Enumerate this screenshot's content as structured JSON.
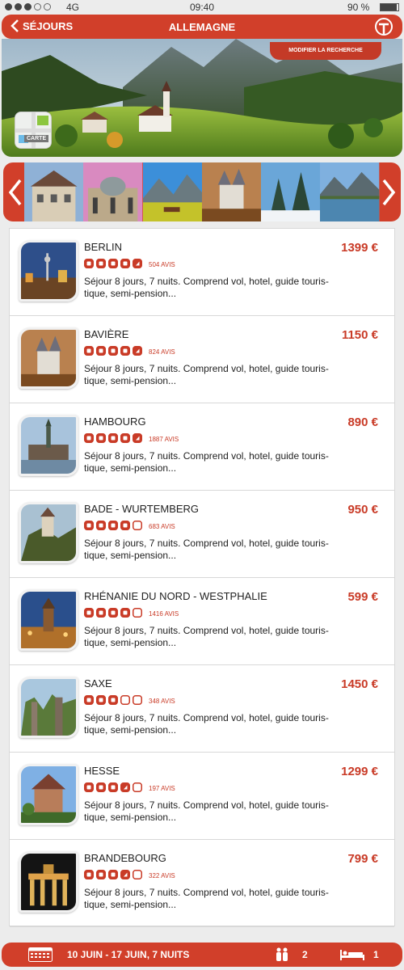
{
  "status": {
    "network": "4G",
    "time": "09:40",
    "battery_text": "90 %",
    "battery_level": 0.9,
    "signal_bars": 5,
    "signal_filled": 3
  },
  "nav": {
    "back_label": "SÉJOURS",
    "title": "ALLEMAGNE",
    "logo_icon": "brand-logo-icon"
  },
  "hero": {
    "modify_label": "MODIFIER LA RECHERCHE",
    "map_label": "CARTE"
  },
  "carousel": {
    "thumbs": [
      "city-hall",
      "palace",
      "alpine-lake",
      "castle",
      "snowy-forest",
      "mountain-lake"
    ]
  },
  "colors": {
    "accent": "#d13f2a",
    "price": "#c93b27",
    "background": "#ececec"
  },
  "items": [
    {
      "name": "BERLIN",
      "price": "1399 €",
      "rating": 4.5,
      "reviews": "504 AVIS",
      "desc": "Séjour 8 jours, 7 nuits. Comprend vol, hotel, guide touris-tique, semi-pension...",
      "photo": "city-night"
    },
    {
      "name": "BAVIÈRE",
      "price": "1150 €",
      "rating": 4.5,
      "reviews": "824 AVIS",
      "desc": "Séjour 8 jours, 7 nuits. Comprend vol, hotel, guide touris-tique, semi-pension...",
      "photo": "castle"
    },
    {
      "name": "HAMBOURG",
      "price": "890 €",
      "rating": 4.5,
      "reviews": "1887 AVIS",
      "desc": "Séjour 8 jours, 7 nuits. Comprend vol, hotel, guide touris-tique, semi-pension...",
      "photo": "harbour"
    },
    {
      "name": "BADE - WURTEMBERG",
      "price": "950 €",
      "rating": 4,
      "reviews": "683 AVIS",
      "desc": "Séjour 8 jours, 7 nuits. Comprend vol, hotel, guide touris-tique, semi-pension...",
      "photo": "cliff-castle"
    },
    {
      "name": "RHÉNANIE DU NORD - WESTPHALIE",
      "price": "599 €",
      "rating": 4,
      "reviews": "1416 AVIS",
      "desc": "Séjour 8 jours, 7 nuits. Comprend vol, hotel, guide touris-tique, semi-pension...",
      "photo": "town-dusk"
    },
    {
      "name": "SAXE",
      "price": "1450 €",
      "rating": 3,
      "reviews": "348 AVIS",
      "desc": "Séjour 8 jours, 7 nuits. Comprend vol, hotel, guide touris-tique, semi-pension...",
      "photo": "rocks"
    },
    {
      "name": "HESSE",
      "price": "1299 €",
      "rating": 3.5,
      "reviews": "197 AVIS",
      "desc": "Séjour 8 jours, 7 nuits. Comprend vol, hotel, guide touris-tique, semi-pension...",
      "photo": "church"
    },
    {
      "name": "BRANDEBOURG",
      "price": "799 €",
      "rating": 3.5,
      "reviews": "322 AVIS",
      "desc": "Séjour 8 jours, 7 nuits. Comprend vol, hotel, guide touris-tique, semi-pension...",
      "photo": "gate-night"
    }
  ],
  "footer": {
    "dates": "10 JUIN - 17 JUIN, 7 NUITS",
    "people": "2",
    "rooms": "1"
  }
}
